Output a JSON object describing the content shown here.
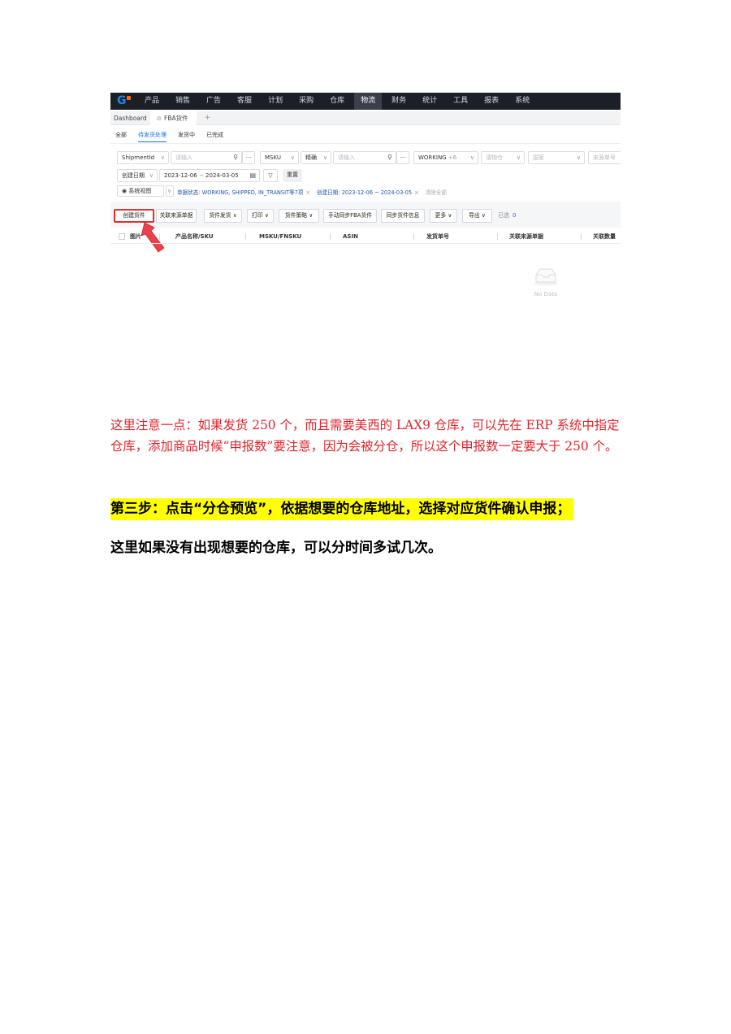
{
  "screenshot": {
    "nav": [
      "产品",
      "销售",
      "广告",
      "客服",
      "计划",
      "采购",
      "仓库",
      "物流",
      "财务",
      "统计",
      "工具",
      "报表",
      "系统"
    ],
    "nav_active": "物流",
    "tabs": {
      "dashboard": "Dashboard",
      "fba": "FBA货件",
      "plus": "+"
    },
    "subtabs": [
      "全部",
      "待发货处理",
      "发货中",
      "已完成"
    ],
    "filters": {
      "shipment_id": "ShipmentId",
      "input_placeholder": "请输入",
      "msku": "MSKU",
      "precise": "精确",
      "working": "WORKING",
      "working_more": "+6",
      "logistics_channel": "请物仓",
      "country": "国家",
      "source_no": "来源单号",
      "create_date": "创建日期",
      "date_start": "2023-12-06",
      "date_sep": "~",
      "date_end": "2024-03-05",
      "reset": "重置",
      "system_view": "系统视图"
    },
    "chips": {
      "status": "单据状态: WORKING, SHIPPED, IN_TRANSIT等7项",
      "date": "创建日期: 2023-12-06 ~ 2024-03-05",
      "clear_all": "清除全部"
    },
    "buttons": {
      "create": "创建货件",
      "link_source": "关联来源单据",
      "shipment": "货件发货",
      "print": "打印",
      "shipment_strategy": "货件策略",
      "manual_sync": "手动同步FBA货件",
      "sync_info": "同步货件信息",
      "more": "更多",
      "export": "导出",
      "selected_label": "已选",
      "selected_count": "0"
    },
    "columns": [
      "图片",
      "产品名称/SKU",
      "MSKU/FNSKU",
      "ASIN",
      "发货单号",
      "关联来源单据",
      "关联数量"
    ],
    "empty_text": "No Data"
  },
  "document": {
    "red_paragraph": "这里注意一点：如果发货 250 个，而且需要美西的 LAX9 仓库，可以先在 ERP 系统中指定仓库，添加商品时候“申报数”要注意，因为会被分仓，所以这个申报数一定要大于 250 个。",
    "step3": "第三步：点击“分仓预览”，依据想要的仓库地址，选择对应货件确认申报；",
    "note": "这里如果没有出现想要的仓库，可以分时间多试几次。"
  },
  "colors": {
    "highlight": "#ffff00",
    "red_text": "#e0242b",
    "annotation": "#e03131",
    "nav_bg": "#1b1f27"
  }
}
